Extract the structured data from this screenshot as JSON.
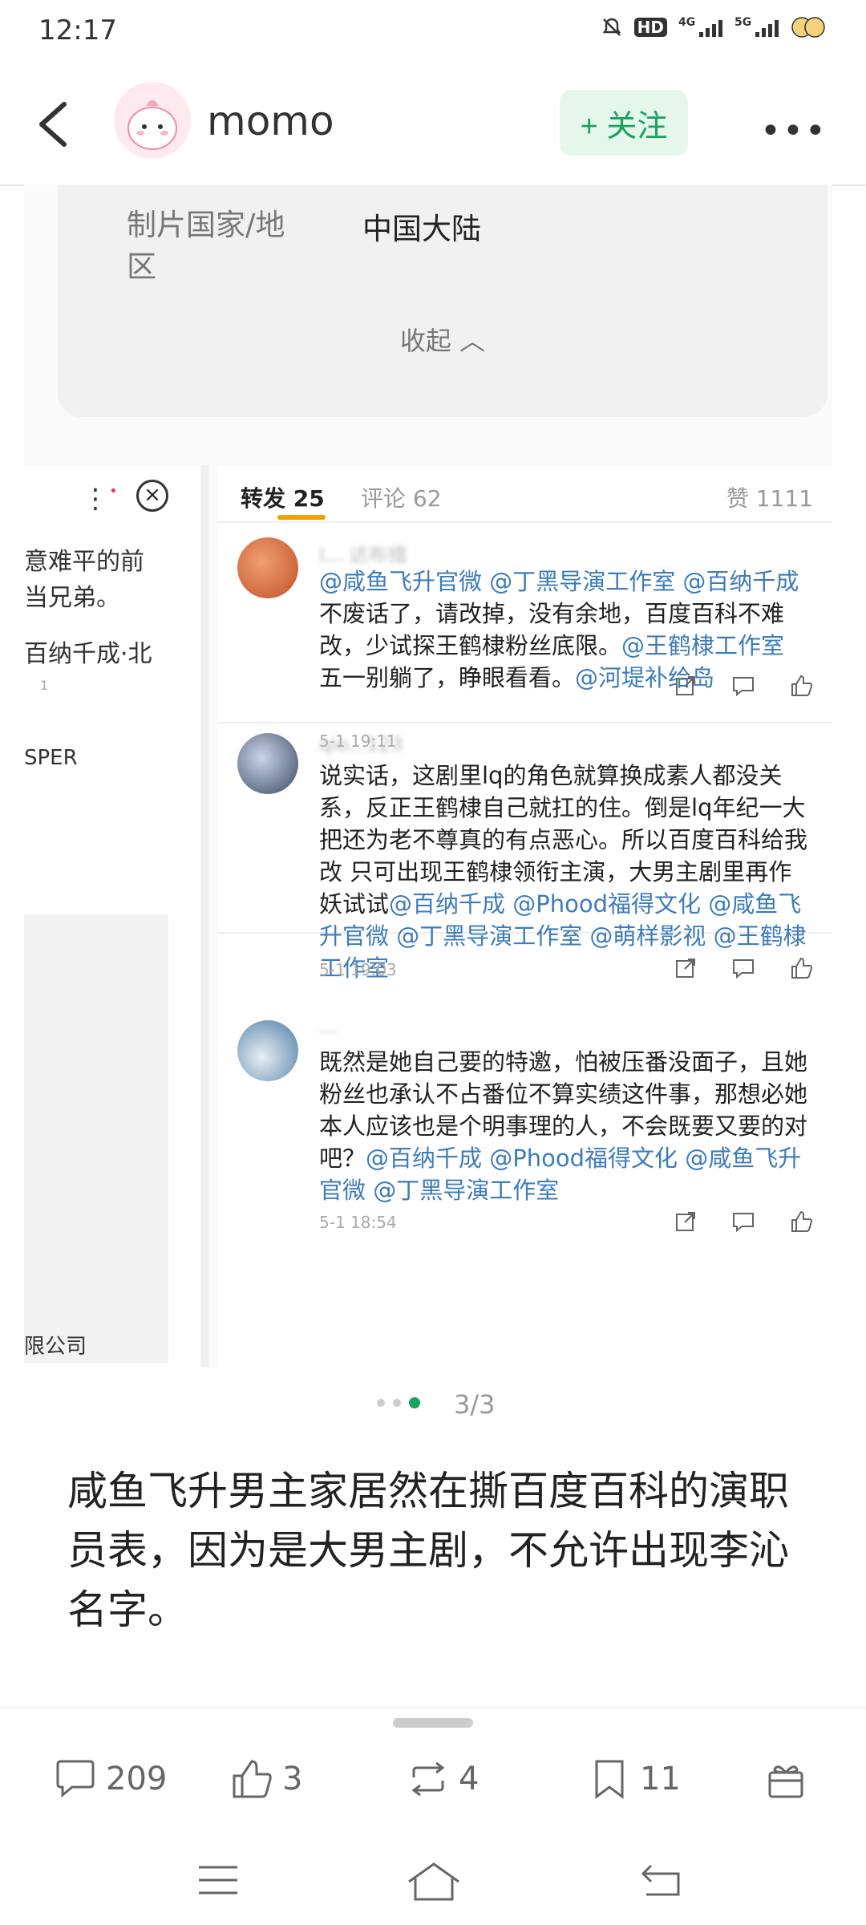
{
  "status_bar": {
    "time": "12:17",
    "icons": [
      "mute-icon",
      "hd-icon",
      "4g-signal",
      "5g-signal",
      "emoji-badge"
    ]
  },
  "header": {
    "username": "momo",
    "follow_label": "+ 关注"
  },
  "info_card": {
    "label": "制片国家/地区",
    "value": "中国大陆",
    "collapse_label": "收起 ︿"
  },
  "left_panel": {
    "lines": [
      "意难平的前",
      "当兄弟。",
      "百纳千成·北",
      "1",
      "SPER",
      "限公司"
    ]
  },
  "tabs": {
    "repost": "转发 25",
    "comment": "评论 62",
    "likes": "赞 1111"
  },
  "comments": [
    {
      "user": "I... 达布措",
      "parts": [
        {
          "t": "@咸鱼飞升官微 @丁黑导演工作室 @百纳千成",
          "m": true
        },
        {
          "t": " 不废话了，请改掉，没有余地，百度百科不难改，少试探王鹤棣粉丝底限。",
          "m": false
        },
        {
          "t": "@王鹤棣工作室",
          "m": true
        },
        {
          "t": " 五一别躺了，睁眼看看。",
          "m": false
        },
        {
          "t": "@河堤补给岛",
          "m": true
        }
      ],
      "time": "5-1 19:11"
    },
    {
      "user": "qio...123",
      "parts": [
        {
          "t": "说实话，这剧里lq的角色就算换成素人都没关系，反正王鹤棣自己就扛的住。倒是lq年纪一大把还为老不尊真的有点恶心。所以百度百科给我改 只可出现王鹤棣领衔主演，大男主剧里再作妖试试",
          "m": false
        },
        {
          "t": "@百纳千成 @Phood福得文化 @咸鱼飞升官微 @丁黑导演工作室 @萌样影视 @王鹤棣工作室",
          "m": true
        }
      ],
      "time": "5-1 19:03"
    },
    {
      "user": "...",
      "parts": [
        {
          "t": "既然是她自己要的特邀，怕被压番没面子，且她粉丝也承认不占番位不算实绩这件事，那想必她本人应该也是个明事理的人，不会既要又要的对吧？",
          "m": false
        },
        {
          "t": "@百纳千成 @Phood福得文化 @咸鱼飞升官微 @丁黑导演工作室",
          "m": true
        }
      ],
      "time": "5-1 18:54"
    }
  ],
  "pager": {
    "count": "3/3"
  },
  "post": {
    "text": "咸鱼飞升男主家居然在撕百度百科的演职员表，因为是大男主剧，不允许出现李沁名字。"
  },
  "actionbar": {
    "comments": "209",
    "likes": "3",
    "reposts": "4",
    "favorites": "11"
  },
  "colors": {
    "accent": "#1aa260",
    "mention": "#3e7cba",
    "tab_underline": "#f2a100"
  }
}
